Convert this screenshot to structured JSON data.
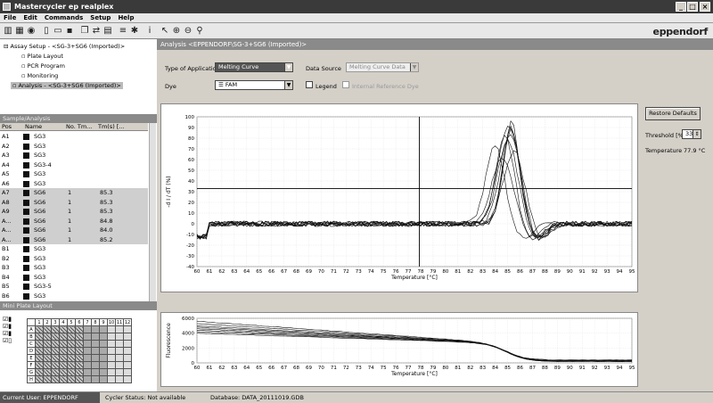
{
  "window": {
    "title": "Mastercycler ep realplex",
    "min": "_",
    "max": "□",
    "close": "×"
  },
  "menu": [
    "File",
    "Edit",
    "Commands",
    "Setup",
    "Help"
  ],
  "logo": "eppendorf",
  "tree": {
    "root": "Assay Setup - <SG-3+SG6 (Imported)>",
    "items": [
      "Plate Layout",
      "PCR Program",
      "Monitoring"
    ],
    "analysis": "Analysis - <SG-3+SG6 (Imported)>"
  },
  "sample_panel": {
    "title": "Sample/Analysis",
    "columns": [
      "Pos",
      "Name",
      "No. Tm...",
      "Tm(s) [..."
    ],
    "rows": [
      {
        "pos": "A1",
        "name": "SG3",
        "no": "",
        "tm": ""
      },
      {
        "pos": "A2",
        "name": "SG3",
        "no": "",
        "tm": ""
      },
      {
        "pos": "A3",
        "name": "SG3",
        "no": "",
        "tm": ""
      },
      {
        "pos": "A4",
        "name": "SG3-4",
        "no": "",
        "tm": ""
      },
      {
        "pos": "A5",
        "name": "SG3",
        "no": "",
        "tm": ""
      },
      {
        "pos": "A6",
        "name": "SG3",
        "no": "",
        "tm": ""
      },
      {
        "pos": "A7",
        "name": "SG6",
        "no": "1",
        "tm": "85.3"
      },
      {
        "pos": "A8",
        "name": "SG6",
        "no": "1",
        "tm": "85.3"
      },
      {
        "pos": "A9",
        "name": "SG6",
        "no": "1",
        "tm": "85.3"
      },
      {
        "pos": "A...",
        "name": "SG6",
        "no": "1",
        "tm": "84.8"
      },
      {
        "pos": "A...",
        "name": "SG6",
        "no": "1",
        "tm": "84.0"
      },
      {
        "pos": "A...",
        "name": "SG6",
        "no": "1",
        "tm": "85.2"
      },
      {
        "pos": "B1",
        "name": "SG3",
        "no": "",
        "tm": ""
      },
      {
        "pos": "B2",
        "name": "SG3",
        "no": "",
        "tm": ""
      },
      {
        "pos": "B3",
        "name": "SG3",
        "no": "",
        "tm": ""
      },
      {
        "pos": "B4",
        "name": "SG3",
        "no": "",
        "tm": ""
      },
      {
        "pos": "B5",
        "name": "SG3-5",
        "no": "",
        "tm": ""
      },
      {
        "pos": "B6",
        "name": "SG3",
        "no": "",
        "tm": ""
      }
    ]
  },
  "plate_panel": {
    "title": "Mini Plate Layout",
    "cols": [
      "1",
      "2",
      "3",
      "4",
      "5",
      "6",
      "7",
      "8",
      "9",
      "10",
      "11",
      "12"
    ],
    "rows_labels": [
      "A",
      "B",
      "C",
      "D",
      "E",
      "F",
      "G",
      "H"
    ]
  },
  "analysis": {
    "header": "Analysis <EPPENDORF\\SG-3+SG6 (Imported)>",
    "type_label": "Type of Application",
    "type_value": "Melting Curve",
    "source_label": "Data Source",
    "source_value": "Melting Curve Data",
    "dye_label": "Dye",
    "dye_value": "FAM",
    "legend_label": "Legend",
    "internal_label": "Internal Reference Dye",
    "restore_label": "Restore Defaults",
    "threshold_label": "Threshold [%]",
    "threshold_value": "33",
    "temperature_label": "Temperature",
    "temperature_value": "77.9 °C"
  },
  "status": {
    "user": "Current User: EPPENDORF",
    "cycler": "Cycler Status: Not available",
    "database": "Database: DATA_20111019.GDB"
  },
  "chart_data": [
    {
      "type": "line",
      "xlabel": "Temperature [°C]",
      "ylabel": "-d I / dT (%)",
      "xlim": [
        60,
        95
      ],
      "ylim": [
        -40,
        100
      ],
      "x_ticks": [
        60,
        61,
        62,
        63,
        64,
        65,
        66,
        67,
        68,
        69,
        70,
        71,
        72,
        73,
        74,
        75,
        76,
        77,
        78,
        79,
        80,
        81,
        82,
        83,
        84,
        85,
        86,
        87,
        88,
        89,
        90,
        91,
        92,
        93,
        94,
        95
      ],
      "y_ticks": [
        -40,
        -30,
        -20,
        -10,
        0,
        10,
        20,
        30,
        40,
        50,
        60,
        70,
        80,
        90,
        100
      ],
      "cursor_x": 77.9,
      "threshold_y": 33,
      "series": [
        {
          "peak": 85.3,
          "height": 95
        },
        {
          "peak": 85.3,
          "height": 90
        },
        {
          "peak": 85.3,
          "height": 88
        },
        {
          "peak": 84.8,
          "height": 82
        },
        {
          "peak": 84.0,
          "height": 72
        },
        {
          "peak": 85.2,
          "height": 85
        },
        {
          "peak": 85.0,
          "height": 78
        },
        {
          "peak": 85.5,
          "height": 68
        },
        {
          "peak": 84.6,
          "height": 62
        },
        {
          "peak": 85.1,
          "height": 92
        }
      ]
    },
    {
      "type": "line",
      "xlabel": "Temperature [°C]",
      "ylabel": "Fluorescence",
      "xlim": [
        60,
        95
      ],
      "ylim": [
        0,
        6000
      ],
      "x_ticks": [
        60,
        61,
        62,
        63,
        64,
        65,
        66,
        67,
        68,
        69,
        70,
        71,
        72,
        73,
        74,
        75,
        76,
        77,
        78,
        79,
        80,
        81,
        82,
        83,
        84,
        85,
        86,
        87,
        88,
        89,
        90,
        91,
        92,
        93,
        94,
        95
      ],
      "y_ticks": [
        0,
        2000,
        4000,
        6000
      ],
      "series": [
        {
          "start": 5600,
          "end": 400
        },
        {
          "start": 5300,
          "end": 350
        },
        {
          "start": 5000,
          "end": 300
        },
        {
          "start": 4800,
          "end": 280
        },
        {
          "start": 4600,
          "end": 250
        },
        {
          "start": 4400,
          "end": 220
        },
        {
          "start": 4200,
          "end": 200
        },
        {
          "start": 4000,
          "end": 180
        }
      ]
    }
  ]
}
